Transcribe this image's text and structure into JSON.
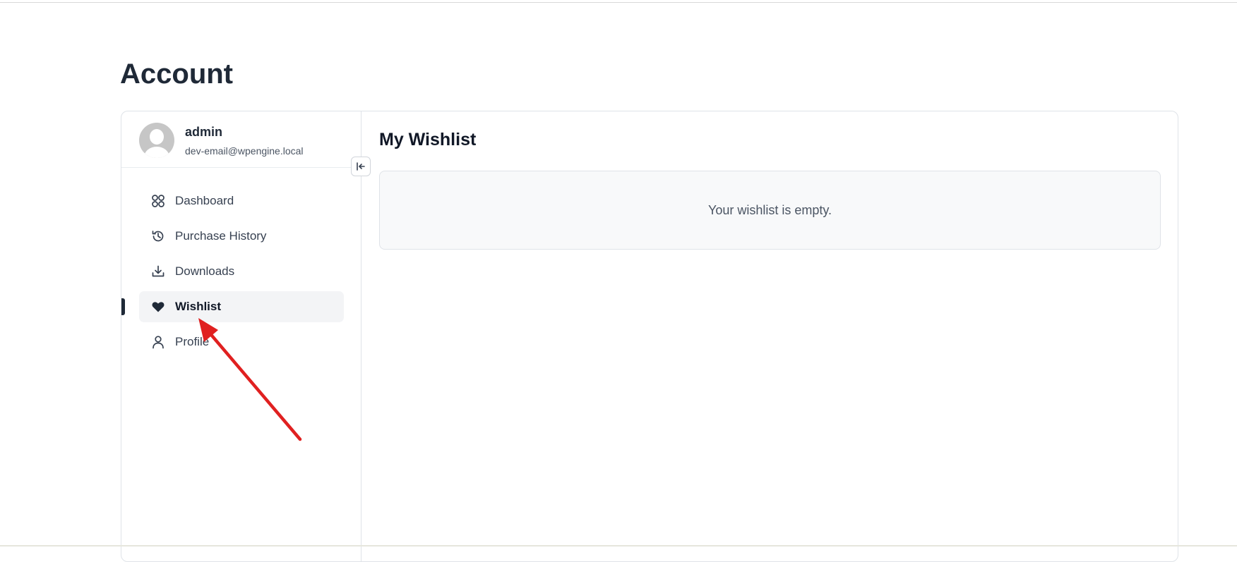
{
  "page": {
    "title": "Account"
  },
  "user": {
    "name": "admin",
    "email": "dev-email@wpengine.local"
  },
  "sidebar": {
    "collapse_icon": "collapse-left-icon",
    "items": [
      {
        "label": "Dashboard",
        "icon": "grid-icon",
        "active": false
      },
      {
        "label": "Purchase History",
        "icon": "history-icon",
        "active": false
      },
      {
        "label": "Downloads",
        "icon": "download-icon",
        "active": false
      },
      {
        "label": "Wishlist",
        "icon": "heart-icon",
        "active": true
      },
      {
        "label": "Profile",
        "icon": "user-icon",
        "active": false
      }
    ]
  },
  "main": {
    "heading": "My Wishlist",
    "empty_message": "Your wishlist is empty."
  },
  "colors": {
    "text_dark": "#1f2937",
    "active_bg": "#f3f4f6",
    "border": "#dfe3e8",
    "annotation_arrow": "#e02020"
  }
}
